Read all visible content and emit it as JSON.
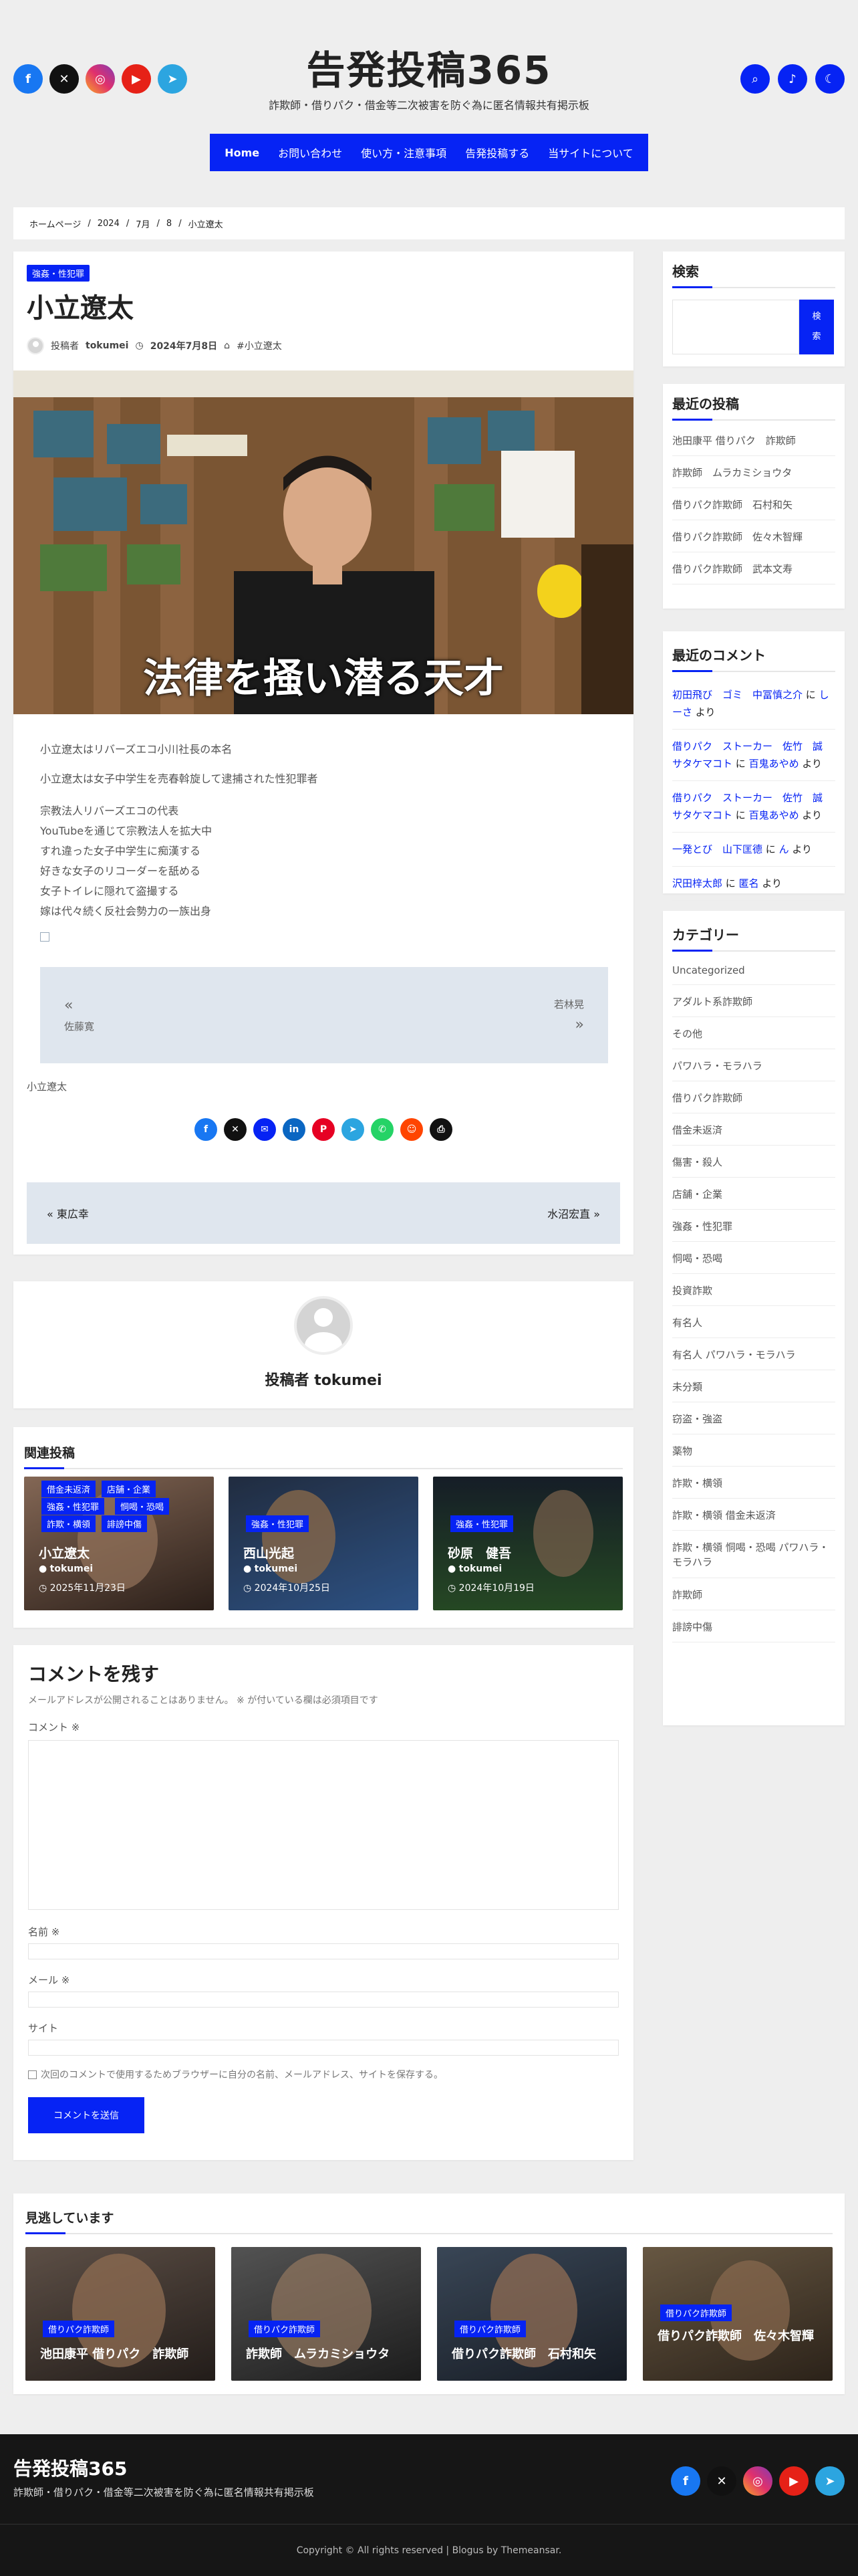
{
  "site": {
    "title": "告発投稿365",
    "description": "詐欺師・借りパク・借金等二次被害を防ぐ為に匿名情報共有掲示板"
  },
  "nav": [
    "Home",
    "お問い合わせ",
    "使い方・注意事項",
    "告発投稿する",
    "当サイトについて"
  ],
  "social_icons": [
    "facebook-icon",
    "x-icon",
    "instagram-icon",
    "youtube-icon",
    "telegram-icon"
  ],
  "colors": {
    "accent": "#0623f4",
    "background": "#eeeeee",
    "footer": "#161616"
  },
  "breadcrumb": [
    "ホームページ",
    "/",
    "2024",
    "/",
    "7月",
    "/",
    "8",
    "/",
    "小立遼太"
  ],
  "post": {
    "category": "強姦・性犯罪",
    "title": "小立遼太",
    "author_prefix": "投稿者",
    "author": "tokumei",
    "date": "2024年7月8日",
    "tag": "#小立遼太",
    "image_caption": "法律を掻い潜る天才",
    "paragraphs": [
      "小立遼太はリバーズエコ小川社長の本名",
      "小立遼太は女子中学生を売春斡旋して逮捕された性犯罪者"
    ],
    "lines": [
      "宗教法人リバーズエコの代表",
      "YouTubeを通じて宗教法人を拡大中",
      "すれ違った女子中学生に痴漢する",
      "好きな女子のリコーダーを舐める",
      "女子トイレに隠れて盗撮する",
      "嫁は代々続く反社会勢力の一族出身"
    ],
    "prev_label": "佐藤寛",
    "next_label": "若林晃",
    "footer_tag": "小立遼太",
    "nav_prev": "東広幸",
    "nav_next": "水沼宏直"
  },
  "author_box": {
    "label": "投稿者",
    "name": "tokumei"
  },
  "related": {
    "title": "関連投稿",
    "items": [
      {
        "tags": [
          "借金未返済",
          "店舗・企業",
          "強姦・性犯罪",
          "恫喝・恐喝",
          "詐欺・横領",
          "誹謗中傷"
        ],
        "name": "小立遼太",
        "author": "tokumei",
        "date": "2025年11月23日"
      },
      {
        "tags": [
          "強姦・性犯罪"
        ],
        "name": "西山光起",
        "author": "tokumei",
        "date": "2024年10月25日"
      },
      {
        "tags": [
          "強姦・性犯罪"
        ],
        "name": "砂原　健吾",
        "author": "tokumei",
        "date": "2024年10月19日"
      }
    ]
  },
  "comment_form": {
    "title": "コメントを残す",
    "note": "メールアドレスが公開されることはありません。 ※ が付いている欄は必須項目です",
    "comment_label": "コメント ※",
    "name_label": "名前 ※",
    "email_label": "メール ※",
    "site_label": "サイト",
    "save_label": "次回のコメントで使用するためブラウザーに自分の名前、メールアドレス、サイトを保存する。",
    "submit_label": "コメントを送信"
  },
  "sidebar": {
    "search_title": "検索",
    "search_button": "検索",
    "recent_title": "最近の投稿",
    "recent": [
      "池田康平 借りパク　詐欺師",
      "詐欺師　ムラカミショウタ",
      "借りパク詐欺師　石村和矢",
      "借りパク詐欺師　佐々木智輝",
      "借りパク詐欺師　武本文寿"
    ],
    "comments_title": "最近のコメント",
    "comments": [
      {
        "author": "初田飛び　ゴミ　中冨慎之介",
        "joiner": " に ",
        "post": "しーさ",
        "suffix": " より"
      },
      {
        "author": "借りパク　ストーカー　佐竹　誠　サタケマコト",
        "joiner": " に ",
        "post": "百鬼あやめ",
        "suffix": " より"
      },
      {
        "author": "借りパク　ストーカー　佐竹　誠　サタケマコト",
        "joiner": " に ",
        "post": "百鬼あやめ",
        "suffix": " より"
      },
      {
        "author": "一発とび　山下匡德",
        "joiner": " に ",
        "post": "ん",
        "suffix": " より"
      },
      {
        "author": "沢田梓太郎",
        "joiner": " に ",
        "post": "匿名",
        "suffix": " より"
      }
    ],
    "cat_title": "カテゴリー",
    "categories": [
      "Uncategorized",
      "アダルト系詐欺師",
      "その他",
      "パワハラ・モラハラ",
      "借りパク詐欺師",
      "借金未返済",
      "傷害・殺人",
      "店舗・企業",
      "強姦・性犯罪",
      "恫喝・恐喝",
      "投資詐欺",
      "有名人",
      "有名人 パワハラ・モラハラ",
      "未分類",
      "窃盗・強盗",
      "薬物",
      "詐欺・横領",
      "詐欺・横領 借金未返済",
      "詐欺・横領 恫喝・恐喝 パワハラ・モラハラ",
      "詐欺師",
      "誹謗中傷"
    ]
  },
  "missed": {
    "title": "見逃しています",
    "items": [
      {
        "tag": "借りパク詐欺師",
        "name": "池田康平 借りパク　詐欺師"
      },
      {
        "tag": "借りパク詐欺師",
        "name": "詐欺師　ムラカミショウタ"
      },
      {
        "tag": "借りパク詐欺師",
        "name": "借りパク詐欺師　石村和矢"
      },
      {
        "tag": "借りパク詐欺師",
        "name": "借りパク詐欺師　佐々木智輝"
      }
    ]
  },
  "footer": {
    "title": "告発投稿365",
    "description": "詐欺師・借りパク・借金等二次被害を防ぐ為に匿名情報共有掲示板",
    "copyright": "Copyright © All rights reserved | Blogus by Themeansar."
  }
}
